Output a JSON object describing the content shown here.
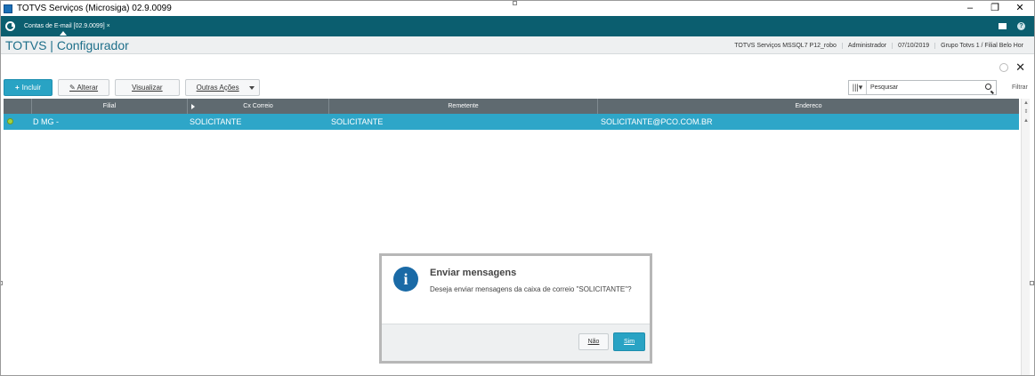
{
  "window": {
    "title": "TOTVS Serviços (Microsiga) 02.9.0099",
    "minimize": "–",
    "restore": "❐",
    "close": "✕"
  },
  "tabbar": {
    "tab_label": "Contas de E-mail [02.9.0099]",
    "tab_close": "×"
  },
  "header": {
    "brand": "TOTVS | Configurador",
    "info": [
      "TOTVS Serviços MSSQL7 P12_robo",
      "Administrador",
      "07/10/2019",
      "Grupo Totvs 1 / Filial Belo Hor"
    ]
  },
  "toolbar": {
    "add_label": "Incluir",
    "edit_label": "Alterar",
    "view_label": "Visualizar",
    "more_label": "Outras Ações"
  },
  "search": {
    "value": "Pesquisar",
    "filter_label": "Filtrar"
  },
  "grid": {
    "columns": [
      "Filial",
      "Cx Correio",
      "Remetente",
      "Endereco"
    ],
    "rows": [
      {
        "filial": "D MG  -",
        "cx_correio": "SOLICITANTE",
        "remetente": "SOLICITANTE",
        "endereco": "SOLICITANTE@PCO.COM.BR"
      }
    ]
  },
  "dialog": {
    "title": "Enviar mensagens",
    "message": "Deseja enviar mensagens da caixa de correio \"SOLICITANTE\"?",
    "no_label": "Não",
    "yes_label": "Sim"
  },
  "colors": {
    "tabbar": "#0b5e6f",
    "accent": "#29a3c4",
    "selected_row": "#2ea6c8",
    "grid_header": "#5f6a70"
  }
}
